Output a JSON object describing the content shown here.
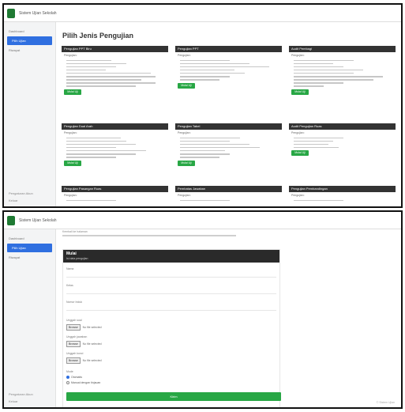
{
  "app": {
    "title": "Sistem Ujian Sekolah"
  },
  "screen1": {
    "sidebar": {
      "items": [
        {
          "label": "Dashboard",
          "active": false
        },
        {
          "label": "Pilih Ujian",
          "active": true
        },
        {
          "label": "Riwayat",
          "active": false
        }
      ],
      "bottom": [
        "Pengaturan Akun",
        "Keluar"
      ]
    },
    "page_title": "Pilih Jenis Pengujian",
    "cards": [
      {
        "title": "Pengujian PPT Biru",
        "sub": "Pengujian:",
        "button": "Mulai Uji",
        "lines": [
          0.45,
          0.6,
          0.5,
          0.4,
          0.85,
          0.9,
          0.75,
          0.9,
          0.7
        ]
      },
      {
        "title": "Pengujian PPT",
        "sub": "Pengujian:",
        "button": "Mulai Uji",
        "lines": [
          0.5,
          0.7,
          0.9,
          0.55,
          0.65,
          0.5,
          0.4
        ]
      },
      {
        "title": "Audit Pembagi",
        "sub": "Pengujian:",
        "button": "Mulai Uji",
        "lines": [
          0.6,
          0.4,
          0.5,
          0.7,
          0.6,
          0.9,
          0.8,
          0.5,
          0.3
        ]
      },
      {
        "title": "Pengujian Dual Arah",
        "sub": "Pengujian:",
        "button": "Mulai Uji",
        "lines": [
          0.55,
          0.6,
          0.7,
          0.5,
          0.8,
          0.7,
          0.5
        ]
      },
      {
        "title": "Pengujian Tabel",
        "sub": "Pengujian:",
        "button": "Mulai Uji",
        "lines": [
          0.6,
          0.5,
          0.7,
          0.8,
          0.45,
          0.5,
          0.4
        ]
      },
      {
        "title": "Audit Pengujian Ruas",
        "sub": "Pengujian:",
        "button": "Mulai Uji",
        "lines": [
          0.5,
          0.4,
          0.35,
          0.45
        ]
      },
      {
        "title": "Pengujian Pasangan Ruas",
        "sub": "Pengujian:",
        "button": "",
        "lines": [
          0.5
        ]
      },
      {
        "title": "Pembatas Jawaban",
        "sub": "Pengujian:",
        "button": "",
        "lines": [
          0.5
        ]
      },
      {
        "title": "Pengujian Pembandingan",
        "sub": "Pengujian:",
        "button": "",
        "lines": [
          0.5
        ]
      }
    ]
  },
  "screen2": {
    "sidebar": {
      "items": [
        {
          "label": "Dashboard",
          "active": false
        },
        {
          "label": "Pilih Ujian",
          "active": true
        },
        {
          "label": "Riwayat",
          "active": false
        }
      ],
      "bottom": [
        "Pengaturan Akun",
        "Keluar"
      ]
    },
    "subheading": "Kembali ke halaman",
    "form": {
      "title": "Mulai",
      "subtitle": "Isi data pengujian",
      "fields": [
        "Nama",
        "Kelas",
        "Nomor Induk"
      ],
      "files": [
        {
          "label": "Unggah soal",
          "button": "Browse",
          "text": "No file selected"
        },
        {
          "label": "Unggah jawaban",
          "button": "Browse",
          "text": "No file selected"
        },
        {
          "label": "Unggah kunci",
          "button": "Browse",
          "text": "No file selected"
        }
      ],
      "mode_label": "Mode",
      "options": [
        {
          "label": "Otomatis",
          "selected": true
        },
        {
          "label": "Manual dengan tinjauan",
          "selected": false
        }
      ],
      "submit": "Kirim"
    },
    "footnote": "© Sistem Ujian"
  }
}
